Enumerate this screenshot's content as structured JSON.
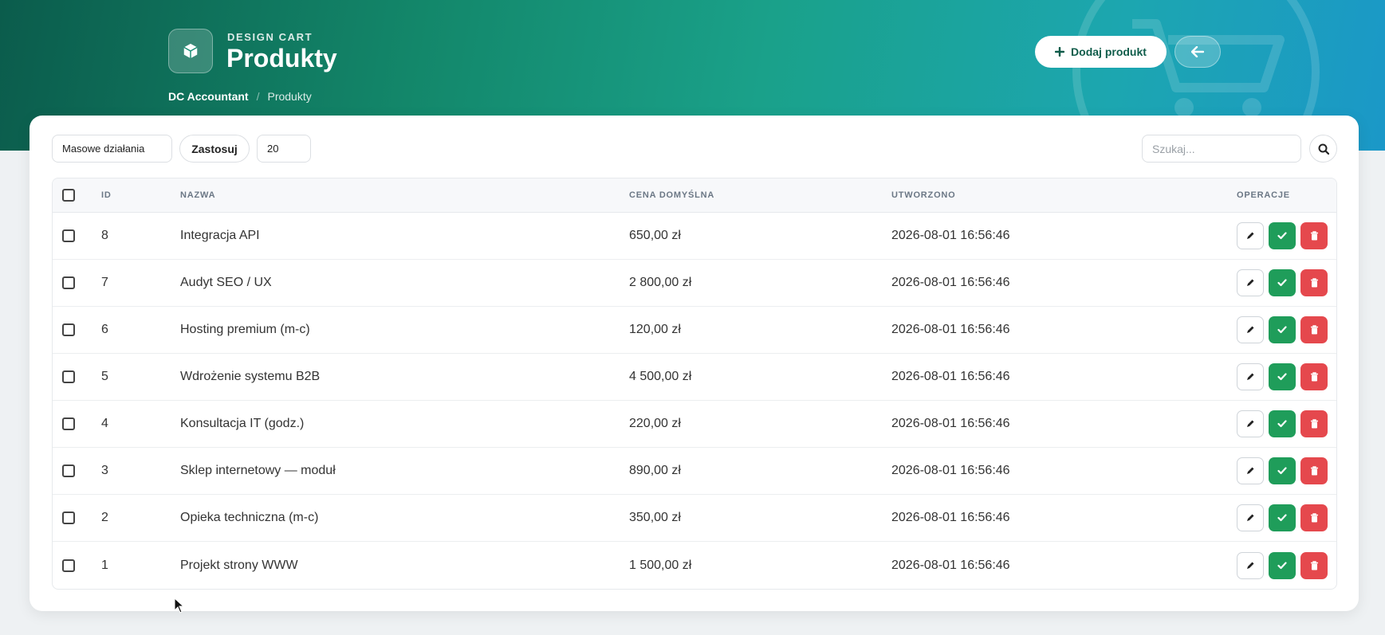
{
  "header": {
    "brand_sub": "DESIGN CART",
    "title": "Produkty",
    "breadcrumb": [
      "DC Accountant",
      "Produkty"
    ],
    "add_button": "Dodaj produkt",
    "accent": "#13876a"
  },
  "toolbar": {
    "bulk_actions": "Masowe działania",
    "apply": "Zastosuj",
    "per_page": "20",
    "search_placeholder": "Szukaj..."
  },
  "table": {
    "headers": [
      "ID",
      "NAZWA",
      "CENA DOMYŚLNA",
      "UTWORZONO",
      "OPERACJE"
    ],
    "rows": [
      {
        "id": "8",
        "name": "Integracja API",
        "price": "650,00 zł",
        "created": "2026-08-01 16:56:46"
      },
      {
        "id": "7",
        "name": "Audyt SEO / UX",
        "price": "2 800,00 zł",
        "created": "2026-08-01 16:56:46"
      },
      {
        "id": "6",
        "name": "Hosting premium (m-c)",
        "price": "120,00 zł",
        "created": "2026-08-01 16:56:46"
      },
      {
        "id": "5",
        "name": "Wdrożenie systemu B2B",
        "price": "4 500,00 zł",
        "created": "2026-08-01 16:56:46"
      },
      {
        "id": "4",
        "name": "Konsultacja IT (godz.)",
        "price": "220,00 zł",
        "created": "2026-08-01 16:56:46"
      },
      {
        "id": "3",
        "name": "Sklep internetowy — moduł",
        "price": "890,00 zł",
        "created": "2026-08-01 16:56:46"
      },
      {
        "id": "2",
        "name": "Opieka techniczna (m-c)",
        "price": "350,00 zł",
        "created": "2026-08-01 16:56:46"
      },
      {
        "id": "1",
        "name": "Projekt strony WWW",
        "price": "1 500,00 zł",
        "created": "2026-08-01 16:56:46"
      }
    ]
  },
  "icons": {
    "brand": "cube-icon",
    "add": "plus-icon",
    "back": "arrow-left-icon",
    "search": "search-icon",
    "edit": "pencil-icon",
    "approve": "check-icon",
    "delete": "trash-icon"
  }
}
